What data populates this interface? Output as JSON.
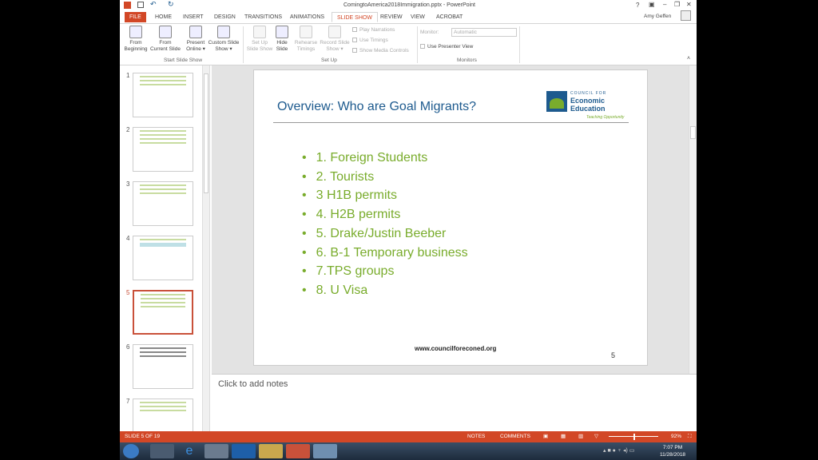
{
  "window": {
    "title": "ComingtoAmerica2018Immigration.pptx - PowerPoint",
    "user": "Amy Geffen",
    "help": "?"
  },
  "tabs": [
    "FILE",
    "HOME",
    "INSERT",
    "DESIGN",
    "TRANSITIONS",
    "ANIMATIONS",
    "SLIDE SHOW",
    "REVIEW",
    "VIEW",
    "ACROBAT"
  ],
  "ribbon": {
    "start": {
      "from_beginning": "From Beginning",
      "from_current": "From Current Slide",
      "present_online": "Present Online ▾",
      "custom": "Custom Slide Show ▾",
      "group": "Start Slide Show"
    },
    "setup": {
      "setup_show": "Set Up Slide Show",
      "hide": "Hide Slide",
      "rehearse": "Rehearse Timings",
      "record": "Record Slide Show ▾",
      "play_narrations": "Play Narrations",
      "use_timings": "Use Timings",
      "show_media": "Show Media Controls",
      "group": "Set Up"
    },
    "monitors": {
      "monitor_label": "Monitor:",
      "monitor_value": "Automatic",
      "presenter_view": "Use Presenter View",
      "group": "Monitors"
    }
  },
  "thumbnails": [
    "1",
    "2",
    "3",
    "4",
    "5",
    "6",
    "7"
  ],
  "selected_slide": 5,
  "slide": {
    "title": "Overview: Who are Goal Migrants?",
    "logo": {
      "line1": "COUNCIL FOR",
      "line2": "Economic",
      "line3": "Education",
      "tagline": "Teaching Opportunity"
    },
    "bullets": [
      "1. Foreign Students",
      "2. Tourists",
      "3  H1B permits",
      "4. H2B permits",
      "5. Drake/Justin Beeber",
      "6. B-1 Temporary business",
      "7.TPS groups",
      "8. U Visa"
    ],
    "footer": "www.councilforeconed.org",
    "number": "5"
  },
  "notes_placeholder": "Click to add notes",
  "status": {
    "slide": "SLIDE 5 OF 19",
    "notes": "NOTES",
    "comments": "COMMENTS",
    "zoom": "92%"
  },
  "clock": {
    "time": "7:07 PM",
    "date": "11/28/2018"
  },
  "colors": {
    "accent": "#d24726",
    "title": "#1d5a8e",
    "bullets": "#79ac2c"
  }
}
